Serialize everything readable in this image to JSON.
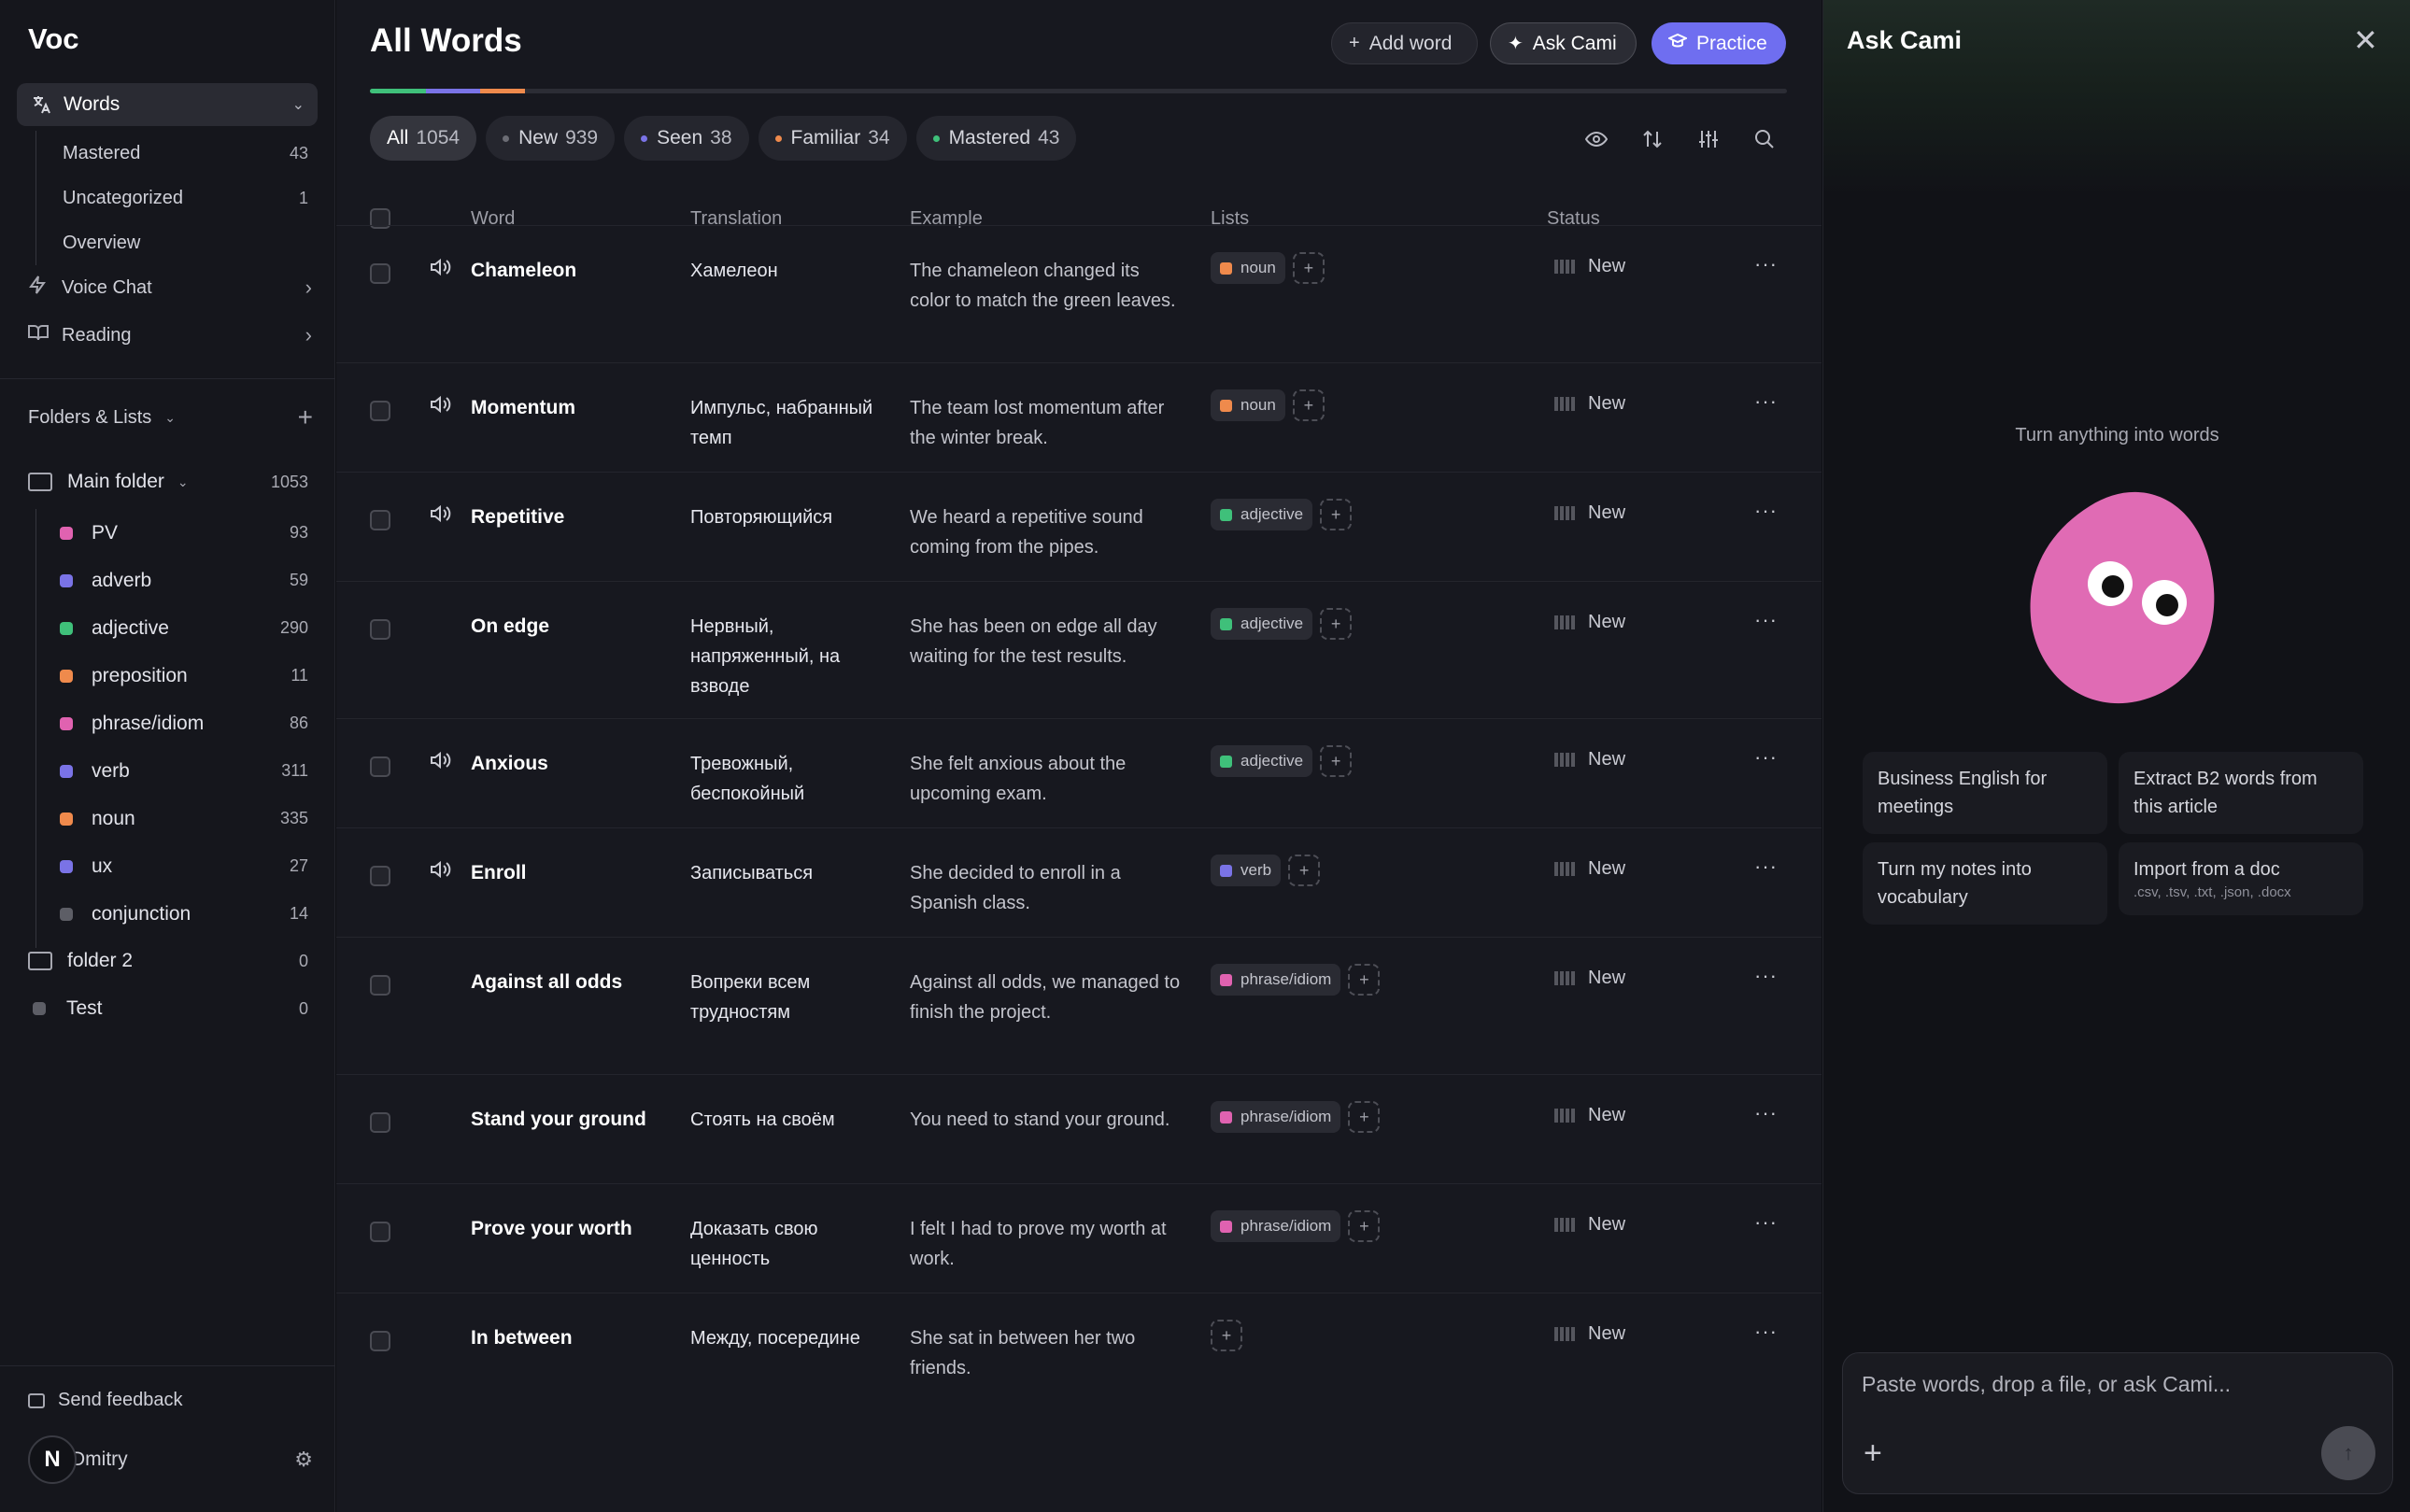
{
  "app": {
    "brand": "Voc"
  },
  "sidebar": {
    "words_label": "Words",
    "sub_items": [
      {
        "label": "Mastered",
        "count": "43"
      },
      {
        "label": "Uncategorized",
        "count": "1"
      },
      {
        "label": "Overview",
        "count": ""
      }
    ],
    "voice_chat": "Voice Chat",
    "reading": "Reading",
    "folders_label": "Folders & Lists",
    "main_folder": {
      "label": "Main folder",
      "count": "1053"
    },
    "lists": [
      {
        "label": "PV",
        "count": "93",
        "color": "#e062b0"
      },
      {
        "label": "adverb",
        "count": "59",
        "color": "#7a73e6"
      },
      {
        "label": "adjective",
        "count": "290",
        "color": "#3fc07a"
      },
      {
        "label": "preposition",
        "count": "11",
        "color": "#ef8a4c"
      },
      {
        "label": "phrase/idiom",
        "count": "86",
        "color": "#e062b0"
      },
      {
        "label": "verb",
        "count": "311",
        "color": "#7a73e6"
      },
      {
        "label": "noun",
        "count": "335",
        "color": "#ef8a4c"
      },
      {
        "label": "ux",
        "count": "27",
        "color": "#7a73e6"
      },
      {
        "label": "conjunction",
        "count": "14",
        "color": "#5d5e66"
      }
    ],
    "folder2": {
      "label": "folder 2",
      "count": "0"
    },
    "test": {
      "label": "Test",
      "count": "0"
    },
    "feedback": "Send feedback",
    "user": {
      "initial": "N",
      "name": "Dmitry"
    }
  },
  "main": {
    "title": "All Words",
    "buttons": {
      "add": "Add word",
      "cami": "Ask Cami",
      "practice": "Practice"
    },
    "filters": [
      {
        "label": "All",
        "count": "1054",
        "dot": ""
      },
      {
        "label": "New",
        "count": "939",
        "dot": "#6b6c74"
      },
      {
        "label": "Seen",
        "count": "38",
        "dot": "#7a73e6"
      },
      {
        "label": "Familiar",
        "count": "34",
        "dot": "#ef8a4c"
      },
      {
        "label": "Mastered",
        "count": "43",
        "dot": "#3fc07a"
      }
    ],
    "columns": {
      "word": "Word",
      "translation": "Translation",
      "example": "Example",
      "lists": "Lists",
      "status": "Status"
    },
    "rows": [
      {
        "word": "Chameleon",
        "translation": "Хамелеон",
        "example": "The chameleon changed its color to match the green leaves.",
        "tag": "noun",
        "tag_color": "#ef8a4c",
        "status": "New",
        "audio": true
      },
      {
        "word": "Momentum",
        "translation": "Импульс, набранный темп",
        "example": "The team lost momentum after the winter break.",
        "tag": "noun",
        "tag_color": "#ef8a4c",
        "status": "New",
        "audio": true
      },
      {
        "word": "Repetitive",
        "translation": "Повторяющийся",
        "example": "We heard a repetitive sound coming from the pipes.",
        "tag": "adjective",
        "tag_color": "#3fc07a",
        "status": "New",
        "audio": true
      },
      {
        "word": "On edge",
        "translation": "Нервный, напряженный, на взводе",
        "example": "She has been on edge all day waiting for the test results.",
        "tag": "adjective",
        "tag_color": "#3fc07a",
        "status": "New",
        "audio": false
      },
      {
        "word": "Anxious",
        "translation": "Тревожный, беспокойный",
        "example": "She felt anxious about the upcoming exam.",
        "tag": "adjective",
        "tag_color": "#3fc07a",
        "status": "New",
        "audio": true
      },
      {
        "word": "Enroll",
        "translation": "Записываться",
        "example": "She decided to enroll in a Spanish class.",
        "tag": "verb",
        "tag_color": "#7a73e6",
        "status": "New",
        "audio": true
      },
      {
        "word": "Against all odds",
        "translation": "Вопреки всем трудностям",
        "example": "Against all odds, we managed to finish the project.",
        "tag": "phrase/idiom",
        "tag_color": "#e062b0",
        "status": "New",
        "audio": false
      },
      {
        "word": "Stand your ground",
        "translation": "Стоять на своём",
        "example": "You need to stand your ground.",
        "tag": "phrase/idiom",
        "tag_color": "#e062b0",
        "status": "New",
        "audio": false
      },
      {
        "word": "Prove your worth",
        "translation": "Доказать свою ценность",
        "example": "I felt I had to prove my worth at work.",
        "tag": "phrase/idiom",
        "tag_color": "#e062b0",
        "status": "New",
        "audio": false
      },
      {
        "word": "In between",
        "translation": "Между, посередине",
        "example": "She sat in between her two friends.",
        "tag": "",
        "tag_color": "",
        "status": "New",
        "audio": false
      }
    ]
  },
  "cami": {
    "title": "Ask Cami",
    "subtitle": "Turn anything into words",
    "suggestions": [
      {
        "label": "Business English for meetings",
        "sub": ""
      },
      {
        "label": "Extract B2 words from this article",
        "sub": ""
      },
      {
        "label": "Turn my notes into vocabulary",
        "sub": ""
      },
      {
        "label": "Import from a doc",
        "sub": ".csv, .tsv, .txt, .json, .docx"
      }
    ],
    "input_placeholder": "Paste words, drop a file, or ask Cami..."
  },
  "colors": {
    "accent": "#6f6ef0",
    "blob": "#e06bb4"
  }
}
